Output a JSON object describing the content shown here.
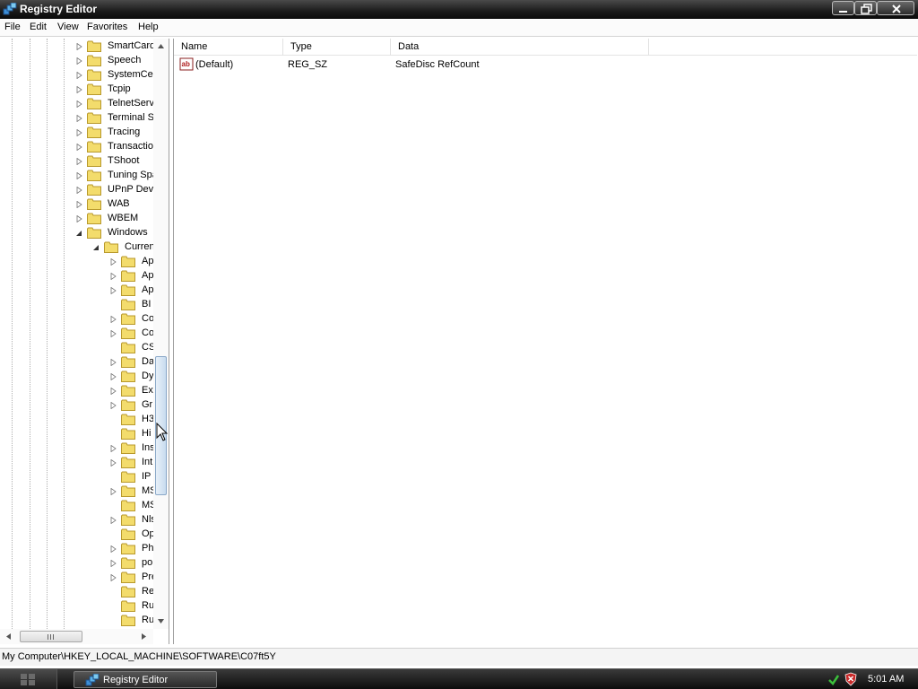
{
  "window": {
    "title": "Registry Editor",
    "minimize_icon": "minimize-icon",
    "maximize_icon": "restore-icon",
    "close_icon": "close-icon"
  },
  "menu": [
    "File",
    "Edit",
    "View",
    "Favorites",
    "Help"
  ],
  "tree": {
    "items": [
      {
        "label": "SmartCard",
        "level": 1,
        "expander": "collapsed"
      },
      {
        "label": "Speech",
        "level": 1,
        "expander": "collapsed"
      },
      {
        "label": "SystemCer",
        "level": 1,
        "expander": "collapsed"
      },
      {
        "label": "Tcpip",
        "level": 1,
        "expander": "collapsed"
      },
      {
        "label": "TelnetServ",
        "level": 1,
        "expander": "collapsed"
      },
      {
        "label": "Terminal S",
        "level": 1,
        "expander": "collapsed"
      },
      {
        "label": "Tracing",
        "level": 1,
        "expander": "collapsed"
      },
      {
        "label": "Transactio",
        "level": 1,
        "expander": "collapsed"
      },
      {
        "label": "TShoot",
        "level": 1,
        "expander": "collapsed"
      },
      {
        "label": "Tuning Spa",
        "level": 1,
        "expander": "collapsed"
      },
      {
        "label": "UPnP Devi",
        "level": 1,
        "expander": "collapsed"
      },
      {
        "label": "WAB",
        "level": 1,
        "expander": "collapsed"
      },
      {
        "label": "WBEM",
        "level": 1,
        "expander": "collapsed"
      },
      {
        "label": "Windows",
        "level": 1,
        "expander": "expanded"
      },
      {
        "label": "Curren",
        "level": 2,
        "expander": "expanded"
      },
      {
        "label": "Ap",
        "level": 3,
        "expander": "collapsed"
      },
      {
        "label": "Ap",
        "level": 3,
        "expander": "collapsed"
      },
      {
        "label": "Ap",
        "level": 3,
        "expander": "collapsed"
      },
      {
        "label": "BI",
        "level": 3,
        "expander": "none"
      },
      {
        "label": "Co",
        "level": 3,
        "expander": "collapsed"
      },
      {
        "label": "Co",
        "level": 3,
        "expander": "collapsed"
      },
      {
        "label": "CS",
        "level": 3,
        "expander": "none"
      },
      {
        "label": "Da",
        "level": 3,
        "expander": "collapsed"
      },
      {
        "label": "Dy",
        "level": 3,
        "expander": "collapsed"
      },
      {
        "label": "Ex",
        "level": 3,
        "expander": "collapsed"
      },
      {
        "label": "Gr",
        "level": 3,
        "expander": "collapsed"
      },
      {
        "label": "H3",
        "level": 3,
        "expander": "none"
      },
      {
        "label": "Hi",
        "level": 3,
        "expander": "none"
      },
      {
        "label": "Ins",
        "level": 3,
        "expander": "collapsed"
      },
      {
        "label": "Int",
        "level": 3,
        "expander": "collapsed"
      },
      {
        "label": "IP",
        "level": 3,
        "expander": "none"
      },
      {
        "label": "MS",
        "level": 3,
        "expander": "collapsed"
      },
      {
        "label": "MS",
        "level": 3,
        "expander": "none"
      },
      {
        "label": "Nls",
        "level": 3,
        "expander": "collapsed"
      },
      {
        "label": "Op",
        "level": 3,
        "expander": "none"
      },
      {
        "label": "Ph",
        "level": 3,
        "expander": "collapsed"
      },
      {
        "label": "po",
        "level": 3,
        "expander": "collapsed"
      },
      {
        "label": "Pre",
        "level": 3,
        "expander": "collapsed"
      },
      {
        "label": "Re",
        "level": 3,
        "expander": "none"
      },
      {
        "label": "Ru",
        "level": 3,
        "expander": "none"
      },
      {
        "label": "Ru",
        "level": 3,
        "expander": "none"
      }
    ]
  },
  "list": {
    "columns": [
      "Name",
      "Type",
      "Data"
    ],
    "rows": [
      {
        "name": "(Default)",
        "type": "REG_SZ",
        "data": "SafeDisc RefCount",
        "icon": "string-value-icon"
      }
    ]
  },
  "status": {
    "path": "My Computer\\HKEY_LOCAL_MACHINE\\SOFTWARE\\C07ft5Y"
  },
  "taskbar": {
    "task_label": "Registry Editor",
    "clock": "5:01 AM"
  },
  "colors": {
    "folder": "#f3dc6c",
    "folder_edge": "#b8992c",
    "titlebar": "#1a1a1a"
  }
}
